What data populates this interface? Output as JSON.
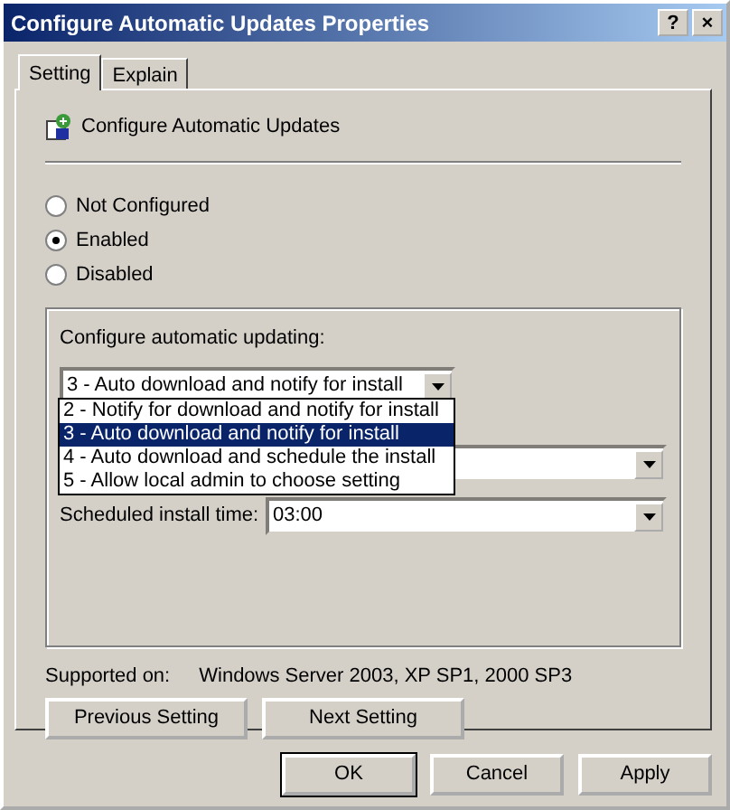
{
  "window": {
    "title": "Configure Automatic Updates Properties",
    "title_buttons": [
      "?",
      "×"
    ]
  },
  "tabs": [
    {
      "label": "Setting",
      "selected": true
    },
    {
      "label": "Explain",
      "selected": false
    }
  ],
  "policy": {
    "title": "Configure Automatic Updates"
  },
  "options": [
    {
      "label": "Not Configured",
      "selected": false
    },
    {
      "label": "Enabled",
      "selected": true
    },
    {
      "label": "Disabled",
      "selected": false
    }
  ],
  "group": {
    "label": "Configure automatic updating:",
    "value": "3 - Auto download and notify for install",
    "dropdown": [
      {
        "label": "2 - Notify for download and notify for install",
        "selected": false
      },
      {
        "label": "3 - Auto download and notify for install",
        "selected": true
      },
      {
        "label": "4 - Auto download and schedule the install",
        "selected": false
      },
      {
        "label": "5 - Allow local admin to choose setting",
        "selected": false
      }
    ],
    "time_label": "Scheduled install time:",
    "time_value": "03:00"
  },
  "supported": {
    "label": "Supported on:",
    "value": "Windows Server 2003, XP SP1, 2000 SP3"
  },
  "nav_buttons": [
    "Previous Setting",
    "Next Setting"
  ],
  "buttons": [
    {
      "label": "OK",
      "default": true
    },
    {
      "label": "Cancel",
      "default": false
    },
    {
      "label": "Apply",
      "default": false
    }
  ]
}
